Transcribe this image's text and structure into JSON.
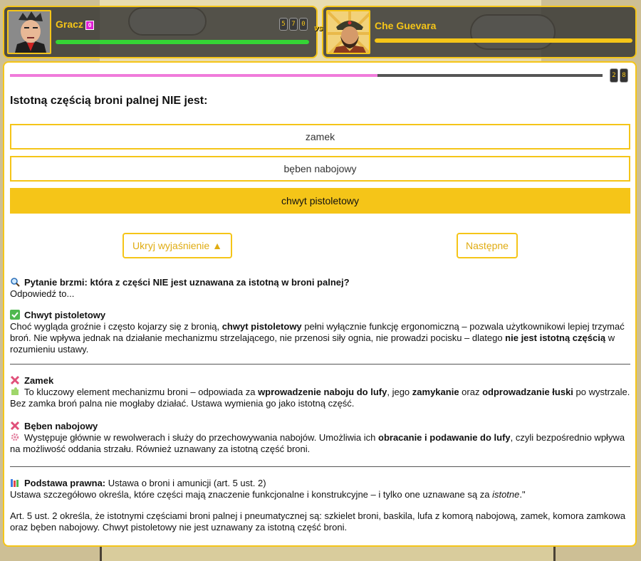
{
  "players": {
    "left": {
      "name": "Gracz",
      "level": "0",
      "score_digits": [
        "5",
        "7",
        "0"
      ],
      "health": 1.0
    },
    "right": {
      "name": "Che Guevara",
      "health": 1.0
    }
  },
  "vs_label": "vs",
  "quiz": {
    "progress": 0.62,
    "counter_digits": [
      "2",
      "8"
    ],
    "question": "Istotną częścią broni palnej NIE jest:",
    "answers": [
      "zamek",
      "bęben nabojowy",
      "chwyt pistoletowy"
    ],
    "selected_index": 2,
    "hide_explanation_label": "Ukryj wyjaśnienie ▲",
    "next_label": "Następne"
  },
  "explanation": {
    "intro_title": "Pytanie brzmi: która z części NIE jest uznawana za istotną w broni palnej?",
    "intro_text": "Odpowiedź to...",
    "s1_title": "Chwyt pistoletowy",
    "s1_a": "Choć wygląda groźnie i często kojarzy się z bronią, ",
    "s1_b": "chwyt pistoletowy",
    "s1_c": " pełni wyłącznie funkcję ergonomiczną – pozwala użytkownikowi lepiej trzymać broń. Nie wpływa jednak na działanie mechanizmu strzelającego, nie przenosi siły ognia, nie prowadzi pocisku – dlatego ",
    "s1_d": "nie jest istotną częścią",
    "s1_e": " w rozumieniu ustawy.",
    "s2_title": "Zamek",
    "s2_a": "To kluczowy element mechanizmu broni – odpowiada za ",
    "s2_b": "wprowadzenie naboju do lufy",
    "s2_c": ", jego ",
    "s2_d": "zamykanie",
    "s2_e": " oraz ",
    "s2_f": "odprowadzanie łuski",
    "s2_g": " po wystrzale. Bez zamka broń palna nie mogłaby działać. Ustawa wymienia go jako istotną część.",
    "s3_title": "Bęben nabojowy",
    "s3_a": "Występuje głównie w rewolwerach i służy do przechowywania nabojów. Umożliwia ich ",
    "s3_b": "obracanie i podawanie do lufy",
    "s3_c": ", czyli bezpośrednio wpływa na możliwość oddania strzału. Również uznawany za istotną część broni.",
    "s4_title": "Podstawa prawna:",
    "s4_title_rest": " Ustawa o broni i amunicji (art. 5 ust. 2)",
    "s4_line_a": "Ustawa szczegółowo określa, które części mają znaczenie funkcjonalne i konstrukcyjne – i tylko one uznawane są za ",
    "s4_line_b": "istotne",
    "s4_line_c": ".\"",
    "s4_para": "Art. 5 ust. 2 określa, że istotnymi częściami broni palnej i pneumatycznej są: szkielet broni, baskila, lufa z komorą nabojową, zamek, komora zamkowa oraz bęben nabojowy. Chwyt pistoletowy nie jest uznawany za istotną część broni."
  },
  "colors": {
    "accent": "#f5c518",
    "progress": "#f07bdb",
    "health_left": "#35d435",
    "badge": "#e01fd6"
  },
  "icons": [
    "magnifier-icon",
    "check-icon",
    "cross-icon",
    "puzzle-icon",
    "gear-icon",
    "books-icon"
  ]
}
